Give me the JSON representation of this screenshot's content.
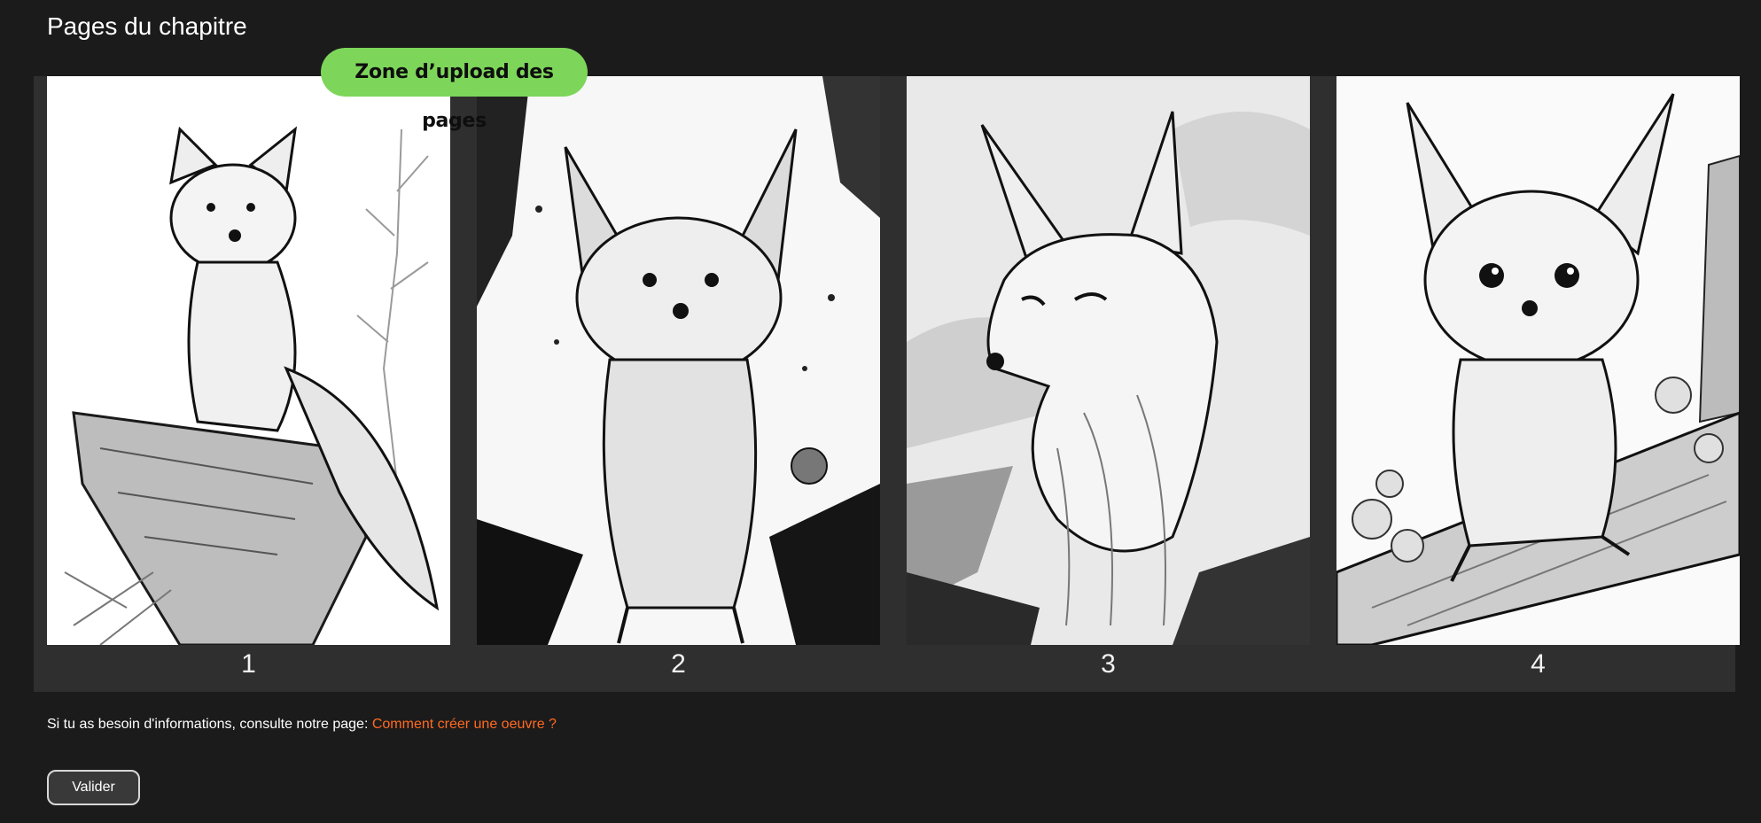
{
  "page": {
    "title": "Pages du chapitre"
  },
  "upload": {
    "badge_label": "Zone d’upload des pages"
  },
  "pages": [
    {
      "number": "1"
    },
    {
      "number": "2"
    },
    {
      "number": "3"
    },
    {
      "number": "4"
    }
  ],
  "info": {
    "text": "Si tu as besoin d'informations, consulte notre page: ",
    "link_label": "Comment créer une oeuvre ?"
  },
  "actions": {
    "validate_label": "Valider"
  },
  "colors": {
    "background": "#1c1b1c",
    "panel": "#2f2f2f",
    "badge": "#7dd65a",
    "link": "#ff6a1f"
  }
}
